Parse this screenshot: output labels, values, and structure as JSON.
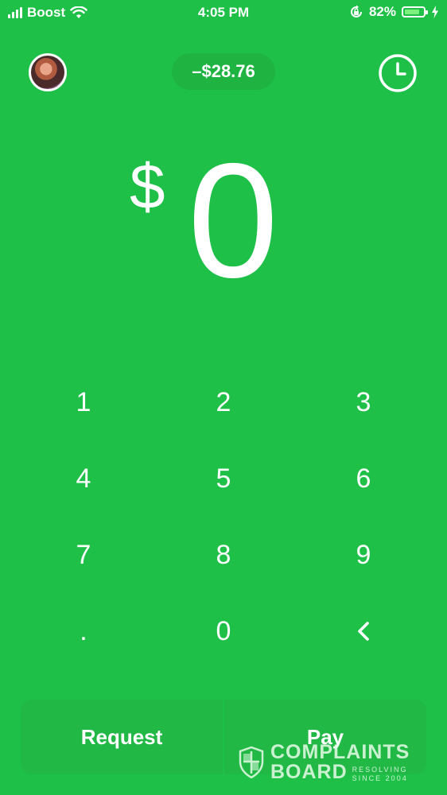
{
  "status_bar": {
    "carrier": "Boost",
    "time": "4:05 PM",
    "battery_percent": "82%",
    "battery_level": 0.82,
    "icons": [
      "signal-icon",
      "wifi-icon",
      "orientation-lock-icon",
      "battery-icon",
      "charging-icon"
    ]
  },
  "header": {
    "balance": "–$28.76",
    "avatar_icon": "avatar",
    "history_icon": "clock-icon"
  },
  "amount": {
    "currency_symbol": "$",
    "value": "0"
  },
  "keypad": {
    "keys": [
      "1",
      "2",
      "3",
      "4",
      "5",
      "6",
      "7",
      "8",
      "9",
      ".",
      "0",
      "<"
    ]
  },
  "actions": {
    "request_label": "Request",
    "pay_label": "Pay"
  },
  "watermark": {
    "line1": "COMPLAINTS",
    "line2": "BOARD",
    "tagline1": "RESOLVING",
    "tagline2": "SINCE 2004"
  },
  "colors": {
    "background": "#1ec047",
    "button": "#21b846",
    "pill": "#1fb342"
  }
}
